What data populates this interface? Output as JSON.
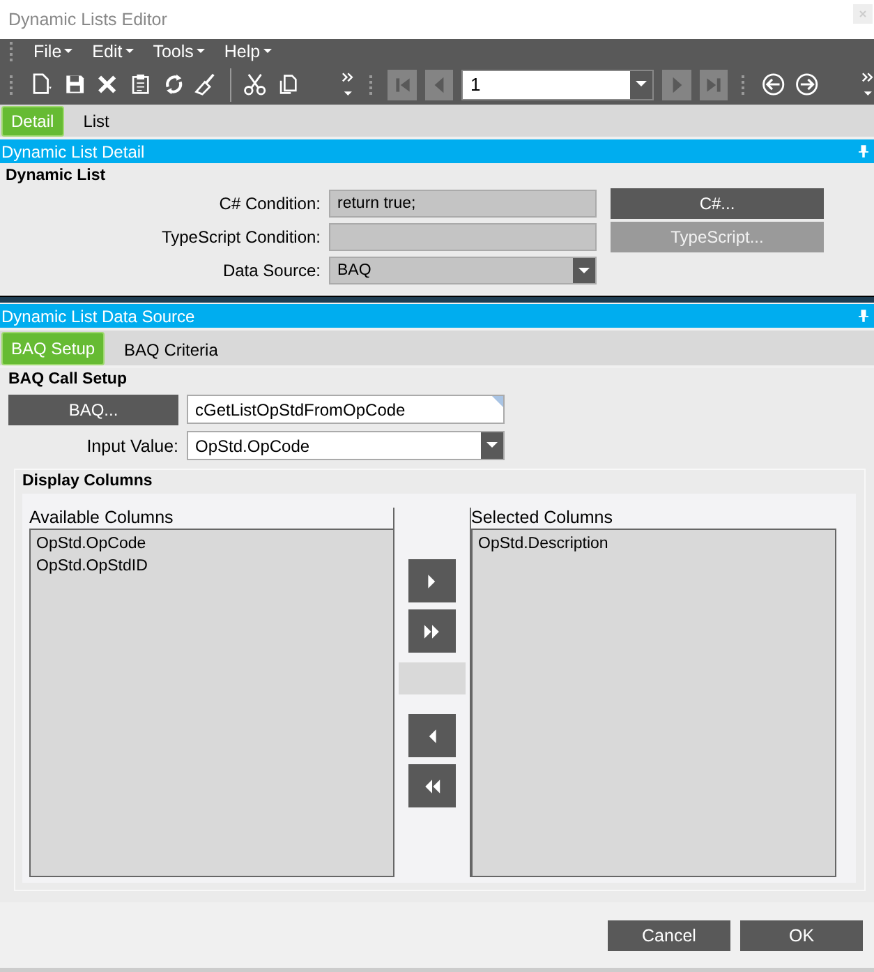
{
  "window": {
    "title": "Dynamic Lists Editor"
  },
  "menu": [
    {
      "label": "File"
    },
    {
      "label": "Edit"
    },
    {
      "label": "Tools"
    },
    {
      "label": "Help"
    }
  ],
  "toolbar": {
    "tools": [
      {
        "kind": "new"
      },
      {
        "kind": "save"
      },
      {
        "kind": "delete"
      },
      {
        "kind": "clipboard"
      },
      {
        "kind": "refresh"
      },
      {
        "kind": "clear"
      }
    ],
    "edit_tools": [
      {
        "kind": "cut"
      },
      {
        "kind": "copy"
      }
    ],
    "nav": [
      {
        "kind": "first",
        "disabled": true
      },
      {
        "kind": "prev",
        "disabled": true
      }
    ],
    "record": "1",
    "nav_after": [
      {
        "kind": "next",
        "disabled": true
      },
      {
        "kind": "last",
        "disabled": true
      }
    ],
    "history": [
      {
        "kind": "back"
      },
      {
        "kind": "forward"
      }
    ]
  },
  "tabs": [
    {
      "label": "Detail",
      "selected": true
    },
    {
      "label": "List",
      "selected": false
    }
  ],
  "detail": {
    "title": "Dynamic List Detail",
    "group": "Dynamic List",
    "fields": [
      {
        "label": "C# Condition:",
        "kind": "text",
        "value": "return true;",
        "button": {
          "label": "C#...",
          "disabled": false
        }
      },
      {
        "label": "TypeScript Condition:",
        "kind": "text",
        "button": {
          "label": "TypeScript...",
          "disabled": true
        }
      },
      {
        "label": "Data Source:",
        "kind": "dropdown",
        "value": "BAQ"
      }
    ]
  },
  "data_source": {
    "title": "Dynamic List Data Source",
    "tabs": [
      {
        "label": "BAQ Setup",
        "selected": true
      },
      {
        "label": "BAQ Criteria",
        "selected": false
      }
    ],
    "setup": {
      "group": "BAQ Call Setup",
      "baq_button": "BAQ...",
      "baq_name": "cGetListOpStdFromOpCode",
      "input_label": "Input Value:",
      "input_value": "OpStd.OpCode"
    },
    "columns": {
      "group": "Display Columns",
      "available": {
        "title": "Available Columns",
        "items": [
          "OpStd.OpCode",
          "OpStd.OpStdID"
        ]
      },
      "selected": {
        "title": "Selected Columns",
        "items": [
          "OpStd.Description"
        ]
      },
      "moves": [
        {
          "kind": "add"
        },
        {
          "kind": "add_all"
        },
        {
          "kind": "gap"
        },
        {
          "kind": "remove"
        },
        {
          "kind": "remove_all"
        }
      ]
    }
  },
  "footer": [
    {
      "label": "Cancel"
    },
    {
      "label": "OK"
    }
  ]
}
